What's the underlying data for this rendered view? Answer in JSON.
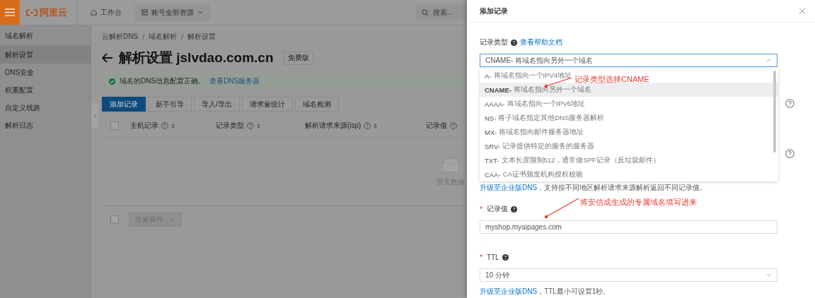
{
  "top_bar": {
    "logo": "阿里云",
    "nav": [
      {
        "label": "工作台",
        "kind": "home"
      },
      {
        "label": "账号全部资源",
        "kind": "dropdown"
      }
    ],
    "search": {
      "placeholder": "搜索..."
    }
  },
  "sidebar": {
    "title": "域名解析",
    "items": [
      {
        "label": "解析设置",
        "selected": true
      },
      {
        "label": "DNS安全",
        "selected": false
      },
      {
        "label": "权重配置",
        "selected": false
      },
      {
        "label": "自定义线路",
        "selected": false
      },
      {
        "label": "解析日志",
        "selected": false
      }
    ]
  },
  "main": {
    "breadcrumb": [
      "云解析DNS",
      "域名解析",
      "解析设置"
    ],
    "breadcrumb_separator": "/",
    "title": "解析设置 jslvdao.com.cn",
    "badge": "免费版",
    "alert": {
      "text": "域名的DNS信息配置正确。",
      "link": "查看DNS服务器"
    },
    "toolbar": [
      {
        "label": "添加记录",
        "primary": true
      },
      {
        "label": "新手引导",
        "primary": false
      },
      {
        "label": "导入/导出",
        "primary": false
      },
      {
        "label": "请求量统计",
        "primary": false
      },
      {
        "label": "域名检测",
        "primary": false
      }
    ],
    "table": {
      "columns": [
        "主机记录",
        "记录类型",
        "解析请求来源(isp)",
        "记录值"
      ],
      "empty_text": "暂无数据"
    },
    "select_all_checked": false,
    "batch_action": "批量操作",
    "batch_checked": false
  },
  "drawer": {
    "title": "添加记录",
    "record_type": {
      "label": "记录类型",
      "help_link": "查看帮助文档",
      "value": "CNAME- 将域名指向另外一个域名",
      "options": [
        {
          "code": "A-",
          "description": "将域名指向一个IPV4地址",
          "selected": false
        },
        {
          "code": "CNAME-",
          "description": "将域名指向另外一个域名",
          "selected": true
        },
        {
          "code": "AAAA-",
          "description": "将域名指向一个IPV6地址",
          "selected": false
        },
        {
          "code": "NS-",
          "description": "将子域名指定其他DNS服务器解析",
          "selected": false
        },
        {
          "code": "MX-",
          "description": "将域名指向邮件服务器地址",
          "selected": false
        },
        {
          "code": "SRV-",
          "description": "记录提供特定的服务的服务器",
          "selected": false
        },
        {
          "code": "TXT-",
          "description": "文本长度限制512，通常做SPF记录（反垃圾邮件）",
          "selected": false
        },
        {
          "code": "CAA-",
          "description": "CA证书颁发机构授权校验",
          "selected": false
        }
      ]
    },
    "upgrade_note": {
      "link": "升级至企业版DNS",
      "text": "，支持按不同地区解析请求来源解析返回不同记录值。"
    },
    "record_value": {
      "label": "记录值",
      "required_mark": "*",
      "value": "myshop.myaipages.com"
    },
    "ttl": {
      "label": "TTL",
      "required_mark": "*",
      "value": "10 分钟",
      "note_link": "升级至企业版DNS",
      "note_text": "，TTL最小可设置1秒。"
    }
  },
  "annotations": [
    {
      "text": "记录类型选择CNAME"
    },
    {
      "text": "将安信成生成的专属域名填写进来"
    }
  ]
}
